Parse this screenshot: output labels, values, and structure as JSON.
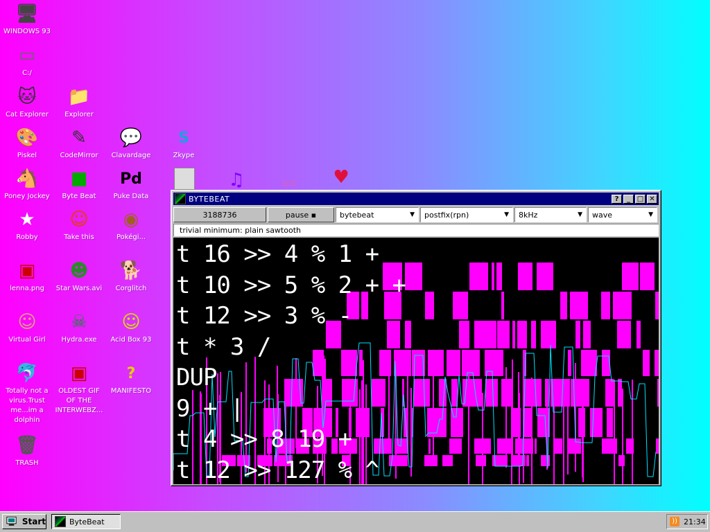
{
  "desktop": {
    "icons": [
      {
        "label": "WINDOWS 93",
        "name": "windows93"
      },
      {
        "label": "C:/",
        "name": "c-drive"
      },
      {
        "label": "Cat Explorer",
        "name": "cat-explorer"
      },
      {
        "label": "Explorer",
        "name": "explorer"
      },
      {
        "label": "Piskel",
        "name": "piskel"
      },
      {
        "label": "CodeMirror",
        "name": "codemirror"
      },
      {
        "label": "Clavardage",
        "name": "clavardage"
      },
      {
        "label": "Zkype",
        "name": "zkype"
      },
      {
        "label": "Poney Jockey",
        "name": "poney-jockey"
      },
      {
        "label": "Byte Beat",
        "name": "byte-beat"
      },
      {
        "label": "Puke Data",
        "name": "puke-data"
      },
      {
        "label": "Robby",
        "name": "robby"
      },
      {
        "label": "Take this",
        "name": "take-this"
      },
      {
        "label": "Pokégi...",
        "name": "pokegi"
      },
      {
        "label": "lenna.png",
        "name": "lenna"
      },
      {
        "label": "Star Wars.avi",
        "name": "star-wars"
      },
      {
        "label": "Corglitch",
        "name": "corglitch"
      },
      {
        "label": "Virtual Girl",
        "name": "virtual-girl"
      },
      {
        "label": "Hydra.exe",
        "name": "hydra"
      },
      {
        "label": "Acid Box 93",
        "name": "acid-box"
      },
      {
        "label": "Totally not a virus.Trust me...im a dolphin",
        "name": "dolphin"
      },
      {
        "label": "OLDEST GIF OF THE INTERWEBZ...",
        "name": "oldest-gif"
      },
      {
        "label": "MANIFESTO",
        "name": "manifesto"
      },
      {
        "label": "TRASH",
        "name": "trash"
      }
    ]
  },
  "window": {
    "title": "BYTEBEAT",
    "controls": {
      "help": "?",
      "minimize": "_",
      "maximize": "□",
      "close": "✕"
    },
    "toolbar": {
      "counter": "3188736",
      "pause_label": "pause ▪",
      "mode": "bytebeat",
      "notation": "postfix(rpn)",
      "rate": "8kHz",
      "view": "wave"
    },
    "hint": "trivial minimum: plain sawtooth",
    "code": "t 16 >> 4 % 1 +\nt 10 >> 5 % 2 + +\nt 12 >> 3 % -\nt * 3 /\nDUP\n9 + |\nt 4 >> 8 19 +\nt 12 >> 127 % ^",
    "colors": {
      "magenta": "#ff00ff",
      "cyan": "#00e0ff",
      "black": "#000000"
    }
  },
  "taskbar": {
    "start_label": "Start",
    "task_label": "ByteBeat",
    "clock": "21:34"
  }
}
